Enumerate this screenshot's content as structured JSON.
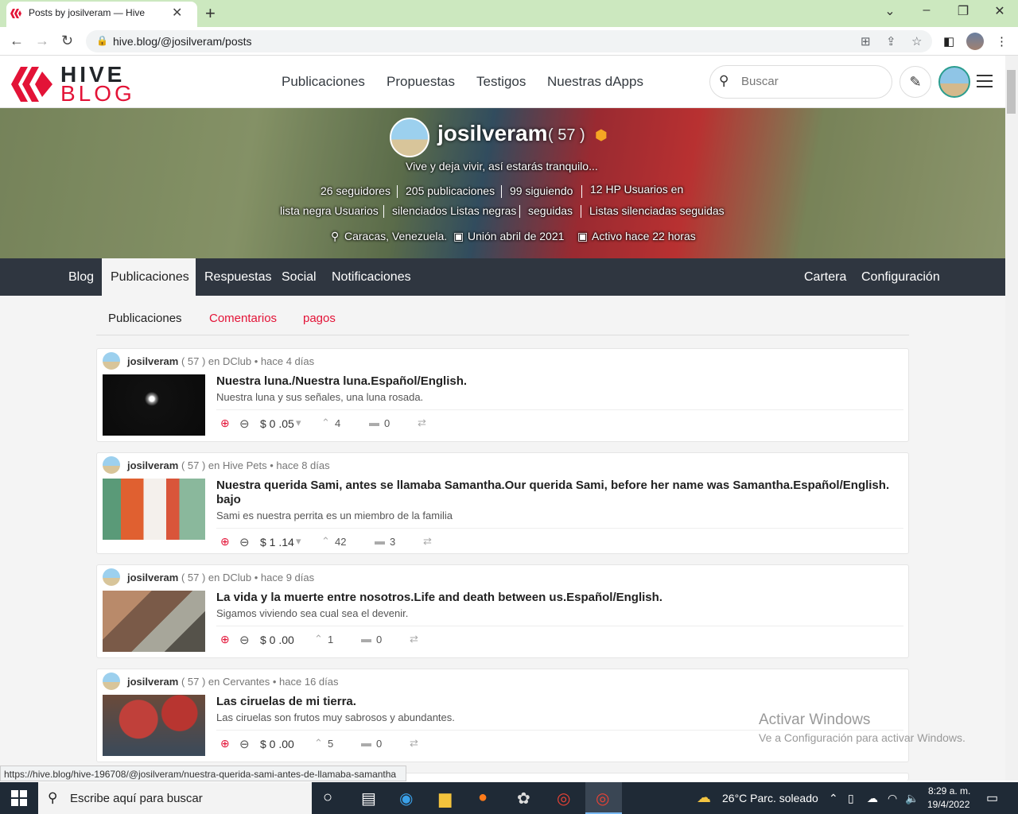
{
  "browser": {
    "tab_title": "Posts by josilveram — Hive",
    "url": "hive.blog/@josilveram/posts"
  },
  "header": {
    "logo_top": "HIVE",
    "logo_bottom": "BLOG",
    "nav": [
      "Publicaciones",
      "Propuestas",
      "Testigos",
      "Nuestras dApps"
    ],
    "search_placeholder": "Buscar"
  },
  "profile": {
    "name": "josilveram",
    "rep": "( 57 )",
    "about": "Vive y deja vivir, así estarás tranquilo...",
    "stats_line1": [
      "26 seguidores",
      "205 publicaciones",
      "99 siguiendo",
      "12 HP Usuarios en"
    ],
    "stats_line2": [
      "lista negra Usuarios",
      "silenciados Listas negras",
      "seguidas",
      "Listas silenciadas seguidas"
    ],
    "location": "Caracas, Venezuela.",
    "joined": "Unión abril de 2021",
    "active": "Activo hace 22 horas"
  },
  "profile_nav": {
    "left": [
      "Blog",
      "Publicaciones",
      "Respuestas",
      "Social",
      "Notificaciones"
    ],
    "right": [
      "Cartera",
      "Configuración"
    ]
  },
  "subtabs": [
    "Publicaciones",
    "Comentarios",
    "pagos"
  ],
  "posts": [
    {
      "author": "josilveram",
      "rep": "( 57 )",
      "community": "en DClub",
      "time": "hace 4 días",
      "title": "Nuestra luna./Nuestra luna.Español/English.",
      "desc": "Nuestra luna y sus señales, una luna rosada.",
      "payout": "$ 0 .05",
      "votes": "4",
      "comments": "0"
    },
    {
      "author": "josilveram",
      "rep": "( 57 )",
      "community": "en Hive Pets",
      "time": "hace 8 días",
      "title": "Nuestra querida Sami, antes se llamaba Samantha.Our querida Sami, before her name was Samantha.Español/English. bajo",
      "desc": "Sami es nuestra perrita es un miembro de la familia",
      "payout": "$ 1 .14",
      "votes": "42",
      "comments": "3"
    },
    {
      "author": "josilveram",
      "rep": "( 57 )",
      "community": "en DClub",
      "time": "hace 9 días",
      "title": "La vida y la muerte entre nosotros.Life and death between us.Español/English.",
      "desc": "Sigamos viviendo sea cual sea el devenir.",
      "payout": "$ 0 .00",
      "votes": "1",
      "comments": "0"
    },
    {
      "author": "josilveram",
      "rep": "( 57 )",
      "community": "en Cervantes",
      "time": "hace 16 días",
      "title": "Las ciruelas de mi tierra.",
      "desc": "Las ciruelas son frutos muy sabrosos y abundantes.",
      "payout": "$ 0 .00",
      "votes": "5",
      "comments": "0"
    }
  ],
  "status_url": "https://hive.blog/hive-196708/@josilveram/nuestra-querida-sami-antes-de-llamaba-samantha",
  "activate": {
    "line1": "Activar Windows",
    "line2": "Ve a Configuración para activar Windows."
  },
  "taskbar": {
    "search": "Escribe aquí para buscar",
    "weather": "26°C  Parc. soleado",
    "time": "8:29 a. m.",
    "date": "19/4/2022"
  }
}
